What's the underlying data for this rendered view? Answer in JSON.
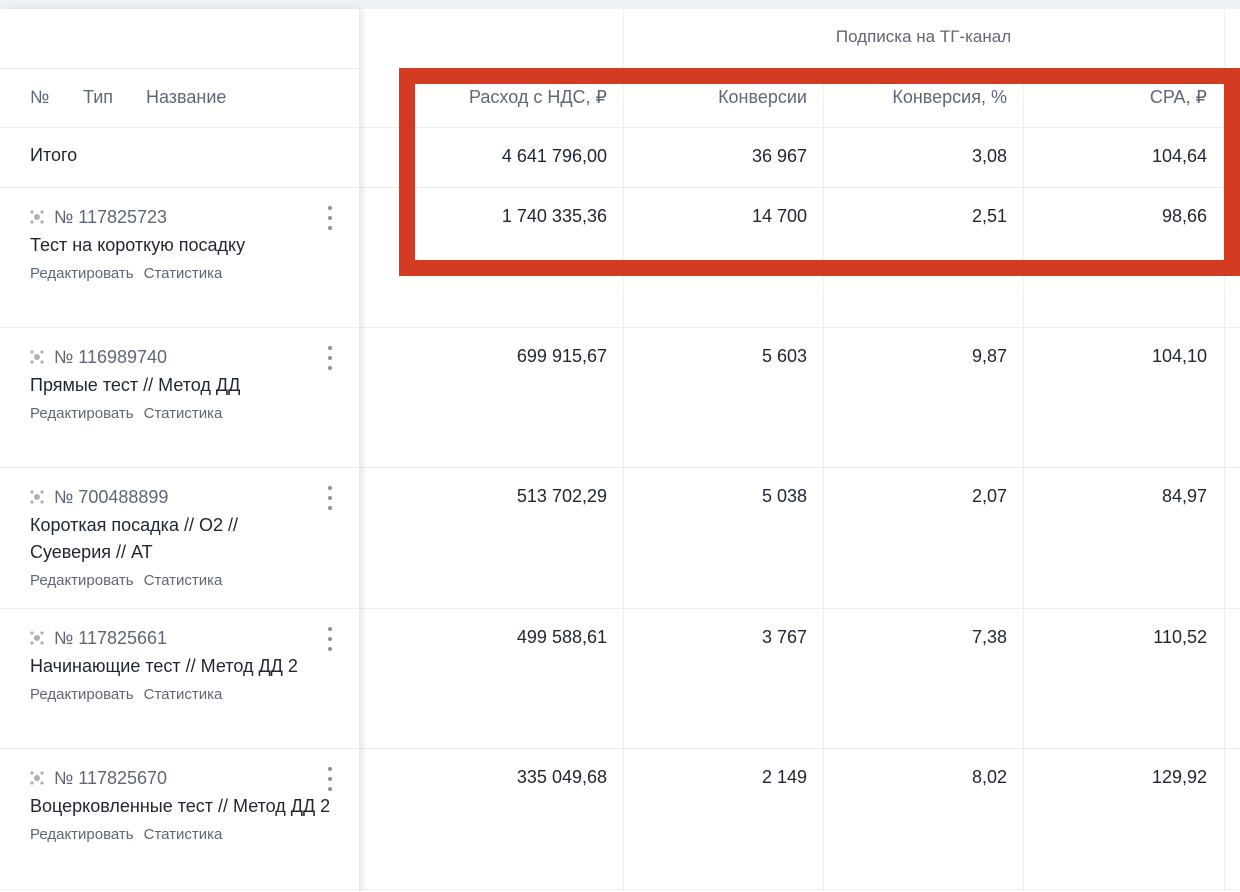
{
  "header": {
    "goal_title": "Подписка на ТГ-канал",
    "col_no": "№",
    "col_type": "Тип",
    "col_name": "Название",
    "metrics": [
      "Расход с НДС, ₽",
      "Конверсии",
      "Конверсия, %",
      "CPA, ₽"
    ]
  },
  "totals": {
    "label": "Итого",
    "values": [
      "4 641 796,00",
      "36 967",
      "3,08",
      "104,64"
    ]
  },
  "actions": {
    "edit": "Редактировать",
    "stats": "Статистика"
  },
  "campaigns": [
    {
      "id": "№ 117825723",
      "name": "Тест на короткую посадку",
      "values": [
        "1 740 335,36",
        "14 700",
        "2,51",
        "98,66"
      ]
    },
    {
      "id": "№ 116989740",
      "name": "Прямые тест // Метод ДД",
      "values": [
        "699 915,67",
        "5 603",
        "9,87",
        "104,10"
      ]
    },
    {
      "id": "№ 700488899",
      "name": "Короткая посадка // O2 // Суеверия // AT",
      "values": [
        "513 702,29",
        "5 038",
        "2,07",
        "84,97"
      ]
    },
    {
      "id": "№ 117825661",
      "name": "Начинающие тест // Метод ДД 2",
      "values": [
        "499 588,61",
        "3 767",
        "7,38",
        "110,52"
      ]
    },
    {
      "id": "№ 117825670",
      "name": "Воцерковленные тест // Метод ДД 2",
      "values": [
        "335 049,68",
        "2 149",
        "8,02",
        "129,92"
      ]
    }
  ],
  "icons": {
    "campaign_type": "smart-campaign-icon",
    "row_menu": "kebab-menu-icon"
  },
  "colors": {
    "highlight": "#d23a22",
    "text": "#1f2533",
    "muted": "#5f6776"
  }
}
